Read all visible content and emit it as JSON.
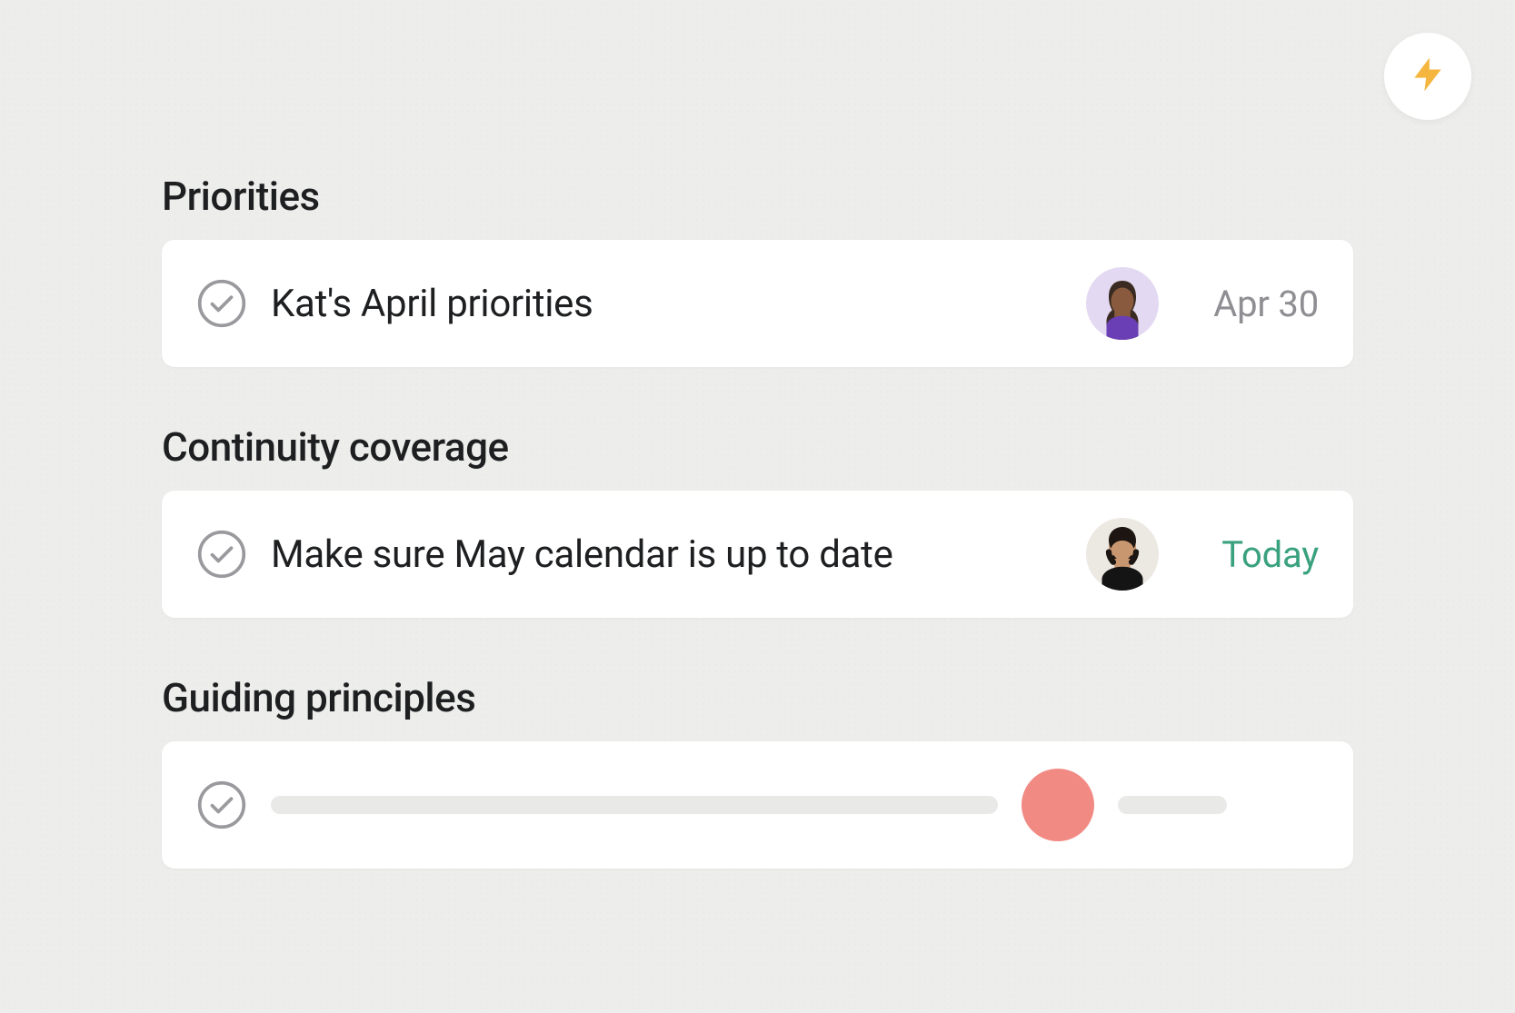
{
  "fab": {
    "icon": "lightning-icon"
  },
  "sections": [
    {
      "title": "Priorities",
      "task": {
        "title": "Kat's April priorities",
        "due": "Apr 30",
        "due_style": "neutral",
        "assignee": "kat",
        "placeholder": false
      }
    },
    {
      "title": "Continuity coverage",
      "task": {
        "title": "Make sure May calendar is up to date",
        "due": "Today",
        "due_style": "today",
        "assignee": "user2",
        "placeholder": false
      }
    },
    {
      "title": "Guiding principles",
      "task": {
        "title": "",
        "due": "",
        "due_style": "neutral",
        "assignee": "placeholder",
        "placeholder": true
      }
    }
  ],
  "colors": {
    "accent_amber": "#f4b63f",
    "due_today": "#3aa17e",
    "avatar_placeholder": "#f28a84"
  }
}
